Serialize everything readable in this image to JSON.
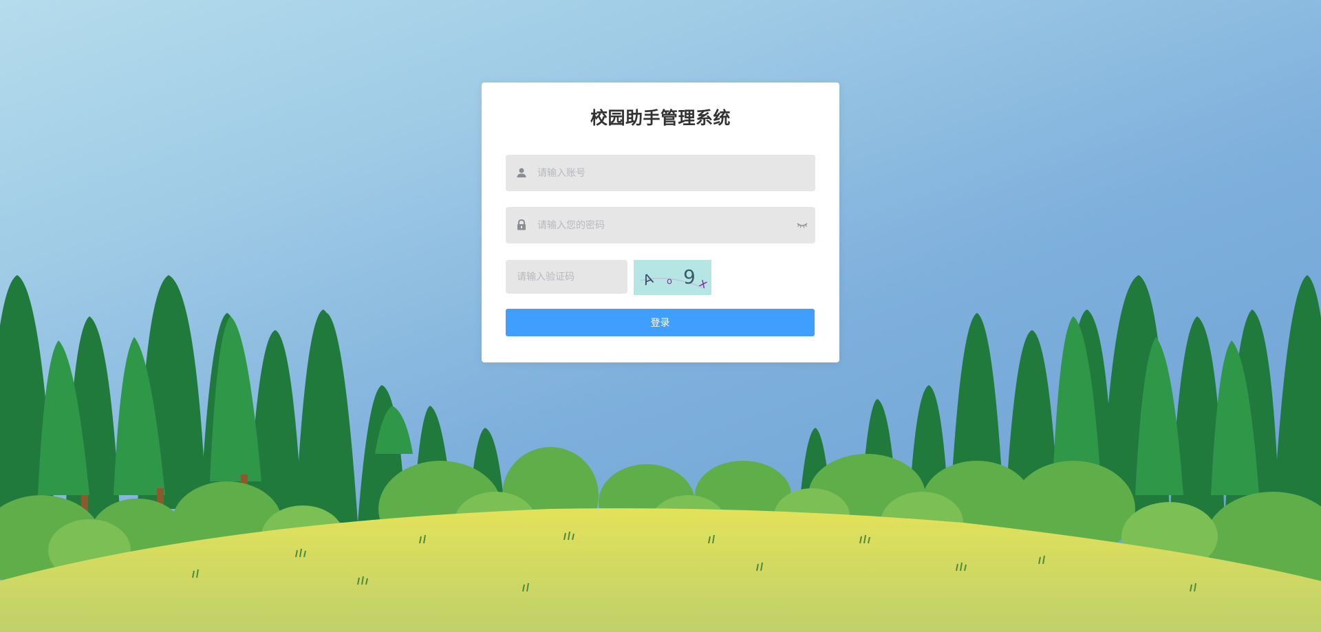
{
  "login": {
    "title": "校园助手管理系统",
    "account_placeholder": "请输入账号",
    "password_placeholder": "请输入您的密码",
    "captcha_placeholder": "请输入验证码",
    "captcha_text": [
      "A",
      "o",
      "9",
      "x"
    ],
    "login_label": "登录"
  },
  "icons": {
    "account": "user-icon",
    "password": "lock-icon",
    "visibility": "eye-closed-icon"
  },
  "colors": {
    "primary": "#409eff",
    "field_background": "#e6e6e6",
    "captcha_background": "#b6e6e4",
    "card_background": "#ffffff",
    "title_text": "#333333"
  }
}
